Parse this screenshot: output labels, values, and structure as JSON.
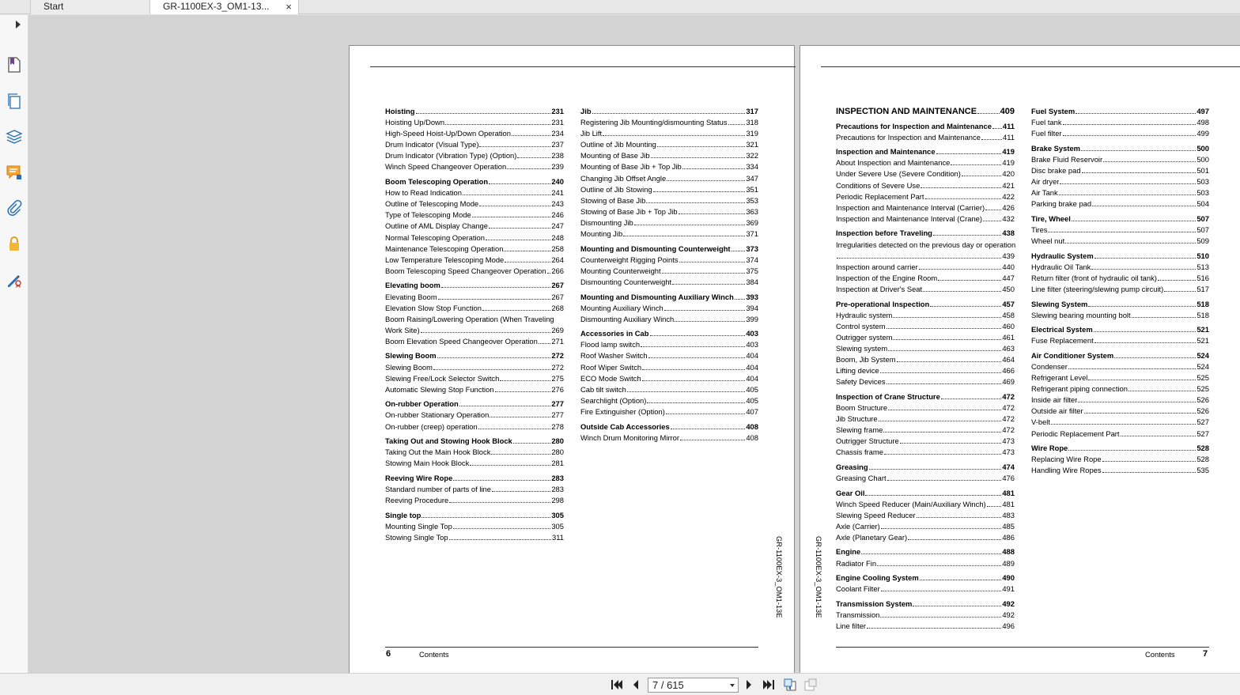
{
  "tabs": [
    {
      "label": "Start"
    },
    {
      "label": "GR-1100EX-3_OM1-13...",
      "close": "×"
    }
  ],
  "sidebar_icons": [
    "bookmark-icon",
    "pages-icon",
    "layers-icon",
    "comments-icon",
    "attachments-icon",
    "security-icon",
    "signature-icon"
  ],
  "navigation": {
    "page_indicator": "7 / 615"
  },
  "left_page": {
    "page_number": "6",
    "footer_label": "Contents",
    "side_code": "GR-1100EX-3_OM1-13E",
    "columns": [
      [
        [
          [
            "Hoisting",
            "231",
            true
          ],
          [
            "Hoisting Up/Down",
            "231",
            false
          ],
          [
            "High-Speed Hoist-Up/Down Operation",
            "234",
            false
          ],
          [
            "Drum Indicator (Visual Type)",
            "237",
            false
          ],
          [
            "Drum Indicator (Vibration Type) (Option)",
            "238",
            false
          ],
          [
            "Winch Speed Changeover Operation",
            "239",
            false
          ]
        ],
        [
          [
            "Boom Telescoping Operation",
            "240",
            true
          ],
          [
            "How to Read Indication",
            "241",
            false
          ],
          [
            "Outline of Telescoping Mode",
            "243",
            false
          ],
          [
            "Type of Telescoping Mode",
            "246",
            false
          ],
          [
            "Outline of AML Display Change",
            "247",
            false
          ],
          [
            "Normal Telescoping Operation",
            "248",
            false
          ],
          [
            "Maintenance Telescoping Operation",
            "258",
            false
          ],
          [
            "Low Temperature Telescoping Mode",
            "264",
            false
          ],
          [
            "Boom Telescoping Speed Changeover Operation",
            "266",
            false
          ]
        ],
        [
          [
            "Elevating boom",
            "267",
            true
          ],
          [
            "Elevating Boom",
            "267",
            false
          ],
          [
            "Elevation Slow Stop Function",
            "268",
            false
          ],
          [
            "Boom Raising/Lowering Operation (When Traveling\nWork Site)",
            "269",
            false
          ],
          [
            "Boom Elevation Speed Changeover Operation",
            "271",
            false
          ]
        ],
        [
          [
            "Slewing Boom",
            "272",
            true
          ],
          [
            "Slewing Boom",
            "272",
            false
          ],
          [
            "Slewing Free/Lock Selector Switch",
            "275",
            false
          ],
          [
            "Automatic Slewing Stop Function",
            "276",
            false
          ]
        ],
        [
          [
            "On-rubber Operation",
            "277",
            true
          ],
          [
            "On-rubber Stationary Operation",
            "277",
            false
          ],
          [
            "On-rubber (creep) operation",
            "278",
            false
          ]
        ],
        [
          [
            "Taking Out and Stowing Hook Block",
            "280",
            true
          ],
          [
            "Taking Out the Main Hook Block",
            "280",
            false
          ],
          [
            "Stowing Main Hook Block",
            "281",
            false
          ]
        ],
        [
          [
            "Reeving Wire Rope",
            "283",
            true
          ],
          [
            "Standard number of parts of line",
            "283",
            false
          ],
          [
            "Reeving Procedure",
            "298",
            false
          ]
        ],
        [
          [
            "Single top",
            "305",
            true
          ],
          [
            "Mounting Single Top",
            "305",
            false
          ],
          [
            "Stowing Single Top",
            "311",
            false
          ]
        ]
      ],
      [
        [
          [
            "Jib",
            "317",
            true
          ],
          [
            "Registering Jib Mounting/dismounting Status",
            "318",
            false
          ],
          [
            "Jib Lift",
            "319",
            false
          ],
          [
            "Outline of Jib Mounting",
            "321",
            false
          ],
          [
            "Mounting of Base Jib",
            "322",
            false
          ],
          [
            "Mounting of Base Jib + Top Jib",
            "334",
            false
          ],
          [
            "Changing Jib Offset Angle",
            "347",
            false
          ],
          [
            "Outline of Jib Stowing",
            "351",
            false
          ],
          [
            "Stowing of Base Jib",
            "353",
            false
          ],
          [
            "Stowing of Base Jib + Top Jib",
            "363",
            false
          ],
          [
            "Dismounting Jib",
            "369",
            false
          ],
          [
            "Mounting Jib",
            "371",
            false
          ]
        ],
        [
          [
            "Mounting and Dismounting Counterweight",
            "373",
            true
          ],
          [
            "Counterweight Rigging Points",
            "374",
            false
          ],
          [
            "Mounting Counterweight",
            "375",
            false
          ],
          [
            "Dismounting Counterweight",
            "384",
            false
          ]
        ],
        [
          [
            "Mounting and Dismounting Auxiliary Winch",
            "393",
            true
          ],
          [
            "Mounting Auxiliary Winch",
            "394",
            false
          ],
          [
            "Dismounting Auxiliary Winch",
            "399",
            false
          ]
        ],
        [
          [
            "Accessories in Cab",
            "403",
            true
          ],
          [
            "Flood lamp switch",
            "403",
            false
          ],
          [
            "Roof Washer Switch",
            "404",
            false
          ],
          [
            "Roof Wiper Switch",
            "404",
            false
          ],
          [
            "ECO Mode Switch",
            "404",
            false
          ],
          [
            "Cab tilt switch",
            "405",
            false
          ],
          [
            "Searchlight (Option)",
            "405",
            false
          ],
          [
            "Fire Extinguisher (Option)",
            "407",
            false
          ]
        ],
        [
          [
            "Outside Cab Accessories",
            "408",
            true
          ],
          [
            "Winch Drum Monitoring Mirror",
            "408",
            false
          ]
        ]
      ]
    ]
  },
  "right_page": {
    "page_number": "7",
    "footer_label": "Contents",
    "side_code": "GR-1100EX-3_OM1-13E",
    "columns": [
      [
        [
          [
            "INSPECTION AND MAINTENANCE",
            "409",
            "big"
          ]
        ],
        [
          [
            "Precautions for Inspection and Maintenance",
            "411",
            true
          ],
          [
            "Precautions for Inspection and Maintenance",
            "411",
            false
          ]
        ],
        [
          [
            "Inspection and Maintenance",
            "419",
            true
          ],
          [
            "About Inspection and Maintenance",
            "419",
            false
          ],
          [
            "Under Severe Use (Severe Condition)",
            "420",
            false
          ],
          [
            "Conditions of Severe Use",
            "421",
            false
          ],
          [
            "Periodic Replacement Part",
            "422",
            false
          ],
          [
            "Inspection and Maintenance Interval (Carrier)",
            "426",
            false
          ],
          [
            "Inspection and Maintenance Interval (Crane)",
            "432",
            false
          ]
        ],
        [
          [
            "Inspection before Traveling",
            "438",
            true
          ],
          [
            "Irregularities detected on the previous day or operation\n",
            "439",
            false
          ],
          [
            "Inspection around carrier",
            "440",
            false
          ],
          [
            "Inspection of the Engine Room",
            "447",
            false
          ],
          [
            "Inspection at Driver's Seat",
            "450",
            false
          ]
        ],
        [
          [
            "Pre-operational Inspection",
            "457",
            true
          ],
          [
            "Hydraulic system",
            "458",
            false
          ],
          [
            "Control system",
            "460",
            false
          ],
          [
            "Outrigger system",
            "461",
            false
          ],
          [
            "Slewing system",
            "463",
            false
          ],
          [
            "Boom, Jib System",
            "464",
            false
          ],
          [
            "Lifting device",
            "466",
            false
          ],
          [
            "Safety Devices",
            "469",
            false
          ]
        ],
        [
          [
            "Inspection of Crane Structure",
            "472",
            true
          ],
          [
            "Boom Structure",
            "472",
            false
          ],
          [
            "Jib Structure",
            "472",
            false
          ],
          [
            "Slewing frame",
            "472",
            false
          ],
          [
            "Outrigger Structure",
            "473",
            false
          ],
          [
            "Chassis frame",
            "473",
            false
          ]
        ],
        [
          [
            "Greasing",
            "474",
            true
          ],
          [
            "Greasing Chart",
            "476",
            false
          ]
        ],
        [
          [
            "Gear Oil",
            "481",
            true
          ],
          [
            "Winch Speed Reducer (Main/Auxiliary Winch)",
            "481",
            false
          ],
          [
            "Slewing Speed Reducer",
            "483",
            false
          ],
          [
            "Axle (Carrier)",
            "485",
            false
          ],
          [
            "Axle (Planetary Gear)",
            "486",
            false
          ]
        ],
        [
          [
            "Engine",
            "488",
            true
          ],
          [
            "Radiator Fin",
            "489",
            false
          ]
        ],
        [
          [
            "Engine Cooling System",
            "490",
            true
          ],
          [
            "Coolant Filter",
            "491",
            false
          ]
        ],
        [
          [
            "Transmission System",
            "492",
            true
          ],
          [
            "Transmission",
            "492",
            false
          ],
          [
            "Line filter",
            "496",
            false
          ]
        ]
      ],
      [
        [
          [
            "Fuel System",
            "497",
            true
          ],
          [
            "Fuel tank",
            "498",
            false
          ],
          [
            "Fuel filter",
            "499",
            false
          ]
        ],
        [
          [
            "Brake System",
            "500",
            true
          ],
          [
            "Brake Fluid Reservoir",
            "500",
            false
          ],
          [
            "Disc brake pad",
            "501",
            false
          ],
          [
            "Air dryer",
            "503",
            false
          ],
          [
            "Air Tank",
            "503",
            false
          ],
          [
            "Parking brake pad",
            "504",
            false
          ]
        ],
        [
          [
            "Tire, Wheel",
            "507",
            true
          ],
          [
            "Tires",
            "507",
            false
          ],
          [
            "Wheel nut",
            "509",
            false
          ]
        ],
        [
          [
            "Hydraulic System",
            "510",
            true
          ],
          [
            "Hydraulic Oil Tank",
            "513",
            false
          ],
          [
            "Return filter (front of hydraulic oil tank)",
            "516",
            false
          ],
          [
            "Line filter (steering/slewing pump circuit)",
            "517",
            false
          ]
        ],
        [
          [
            "Slewing System",
            "518",
            true
          ],
          [
            "Slewing bearing mounting bolt",
            "518",
            false
          ]
        ],
        [
          [
            "Electrical System",
            "521",
            true
          ],
          [
            "Fuse Replacement",
            "521",
            false
          ]
        ],
        [
          [
            "Air Conditioner System",
            "524",
            true
          ],
          [
            "Condenser",
            "524",
            false
          ],
          [
            "Refrigerant Level",
            "525",
            false
          ],
          [
            "Refrigerant piping connection",
            "525",
            false
          ],
          [
            "Inside air filter",
            "526",
            false
          ],
          [
            "Outside air filter",
            "526",
            false
          ],
          [
            "V-belt",
            "527",
            false
          ],
          [
            "Periodic Replacement Part",
            "527",
            false
          ]
        ],
        [
          [
            "Wire Rope",
            "528",
            true
          ],
          [
            "Replacing Wire Rope",
            "528",
            false
          ],
          [
            "Handling Wire Ropes",
            "535",
            false
          ]
        ]
      ]
    ]
  }
}
